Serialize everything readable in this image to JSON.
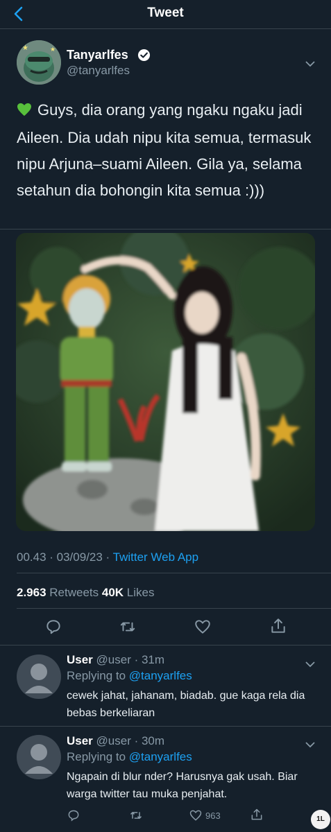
{
  "header": {
    "title": "Tweet"
  },
  "tweet": {
    "author": {
      "name": "Tanyarlfes",
      "handle": "@tanyarlfes",
      "verified": true
    },
    "text": "Guys, dia orang yang ngaku ngaku jadi Aileen. Dia udah nipu kita semua, termasuk nipu Arjuna–suami Aileen. Gila ya, selama setahun dia bohongin kita semua :)))",
    "emoji": "green-heart-icon",
    "time": "00.43 · 03/09/23 · ",
    "source": "Twitter Web App",
    "retweets_count": "2.963",
    "retweets_label": " Retweets ",
    "likes_count": "40K",
    "likes_label": " Likes"
  },
  "replies": [
    {
      "name": "User",
      "meta": " @user · 31m",
      "replying_prefix": "Replying to ",
      "replying_to": "@tanyarlfes",
      "text": "cewek jahat, jahanam, biadab. gue kaga rela dia bebas berkeliaran"
    },
    {
      "name": "User",
      "meta": " @user · 30m",
      "replying_prefix": "Replying to ",
      "replying_to": "@tanyarlfes",
      "text": "Ngapain di blur nder? Harusnya gak usah. Biar warga twitter tau muka penjahat.",
      "like_count": "963"
    }
  ],
  "watermark": "1L",
  "colors": {
    "background": "#15202b",
    "accent": "#1da1f2",
    "muted": "#8899a6",
    "divider": "#38444d"
  }
}
